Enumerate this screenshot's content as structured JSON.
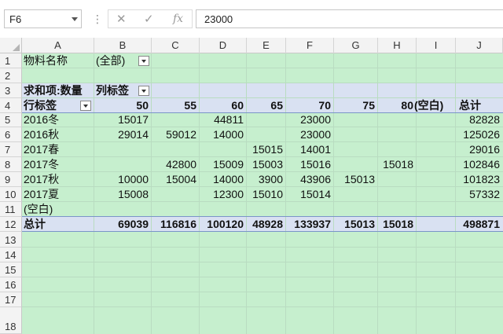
{
  "formula_bar": {
    "name_box": "F6",
    "cancel_icon": "✕",
    "enter_icon": "✓",
    "fx_icon": "fx",
    "value": "23000"
  },
  "columns": [
    "A",
    "B",
    "C",
    "D",
    "E",
    "F",
    "G",
    "H",
    "I",
    "J"
  ],
  "rows": [
    "1",
    "2",
    "3",
    "4",
    "5",
    "6",
    "7",
    "8",
    "9",
    "10",
    "11",
    "12",
    "13",
    "14",
    "15",
    "16",
    "17",
    "18"
  ],
  "pivot": {
    "filter_label": "物料名称",
    "filter_value": "(全部)",
    "sum_label": "求和项:数量",
    "col_label": "列标签",
    "row_label": "行标签",
    "headers": [
      "50",
      "55",
      "60",
      "65",
      "70",
      "75",
      "80",
      "(空白)",
      "总计"
    ],
    "data": [
      {
        "label": "2016冬",
        "values": [
          "15017",
          "",
          "44811",
          "",
          "23000",
          "",
          "",
          "",
          "82828"
        ]
      },
      {
        "label": "2016秋",
        "values": [
          "29014",
          "59012",
          "14000",
          "",
          "23000",
          "",
          "",
          "",
          "125026"
        ]
      },
      {
        "label": "2017春",
        "values": [
          "",
          "",
          "",
          "15015",
          "14001",
          "",
          "",
          "",
          "29016"
        ]
      },
      {
        "label": "2017冬",
        "values": [
          "",
          "42800",
          "15009",
          "15003",
          "15016",
          "",
          "15018",
          "",
          "102846"
        ]
      },
      {
        "label": "2017秋",
        "values": [
          "10000",
          "15004",
          "14000",
          "3900",
          "43906",
          "15013",
          "",
          "",
          "101823"
        ]
      },
      {
        "label": "2017夏",
        "values": [
          "15008",
          "",
          "12300",
          "15010",
          "15014",
          "",
          "",
          "",
          "57332"
        ]
      },
      {
        "label": "(空白)",
        "values": [
          "",
          "",
          "",
          "",
          "",
          "",
          "",
          "",
          ""
        ]
      }
    ],
    "total": {
      "label": "总计",
      "values": [
        "69039",
        "116816",
        "100120",
        "48928",
        "133937",
        "15013",
        "15018",
        "",
        "498871"
      ]
    }
  },
  "colors": {
    "grid_fill": "#c6efce",
    "band_fill": "#d9e1f2",
    "header_fill": "#f3f3f3"
  }
}
